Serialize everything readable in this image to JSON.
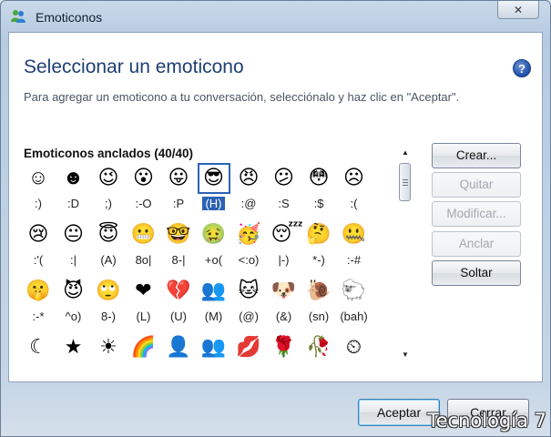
{
  "window": {
    "title": "Emoticonos",
    "close_label": "✕"
  },
  "header": {
    "heading": "Seleccionar un emoticono",
    "help": "?",
    "description": "Para agregar un emoticono a tu conversación, selecciónalo y haz clic en \"Aceptar\"."
  },
  "grid": {
    "title": "Emoticonos anclados (40/40)",
    "selected_index": 5,
    "rows": [
      [
        {
          "face": "☺",
          "code": ":)"
        },
        {
          "face": "☻",
          "code": ":D"
        },
        {
          "face": "😉",
          "code": ";)"
        },
        {
          "face": "😮",
          "code": ":-O"
        },
        {
          "face": "😛",
          "code": ":P"
        },
        {
          "face": "😎",
          "code": "(H)"
        },
        {
          "face": "😠",
          "code": ":@"
        },
        {
          "face": "😕",
          "code": ":S"
        },
        {
          "face": "😳",
          "code": ":$"
        },
        {
          "face": "☹",
          "code": ":("
        }
      ],
      [
        {
          "face": "😢",
          "code": ":'("
        },
        {
          "face": "😐",
          "code": ":|"
        },
        {
          "face": "😇",
          "code": "(A)"
        },
        {
          "face": "😬",
          "code": "8o|"
        },
        {
          "face": "🤓",
          "code": "8-|"
        },
        {
          "face": "🤢",
          "code": "+o("
        },
        {
          "face": "🥳",
          "code": "<:o)"
        },
        {
          "face": "😴",
          "code": "|-)"
        },
        {
          "face": "🤔",
          "code": "*-)"
        },
        {
          "face": "🤐",
          "code": ":-#"
        }
      ],
      [
        {
          "face": "🤫",
          "code": ":-*"
        },
        {
          "face": "😈",
          "code": "^o)"
        },
        {
          "face": "🙄",
          "code": "8-)"
        },
        {
          "face": "❤",
          "code": "(L)"
        },
        {
          "face": "💔",
          "code": "(U)"
        },
        {
          "face": "👥",
          "code": "(M)"
        },
        {
          "face": "🐱",
          "code": "(@)"
        },
        {
          "face": "🐶",
          "code": "(&)"
        },
        {
          "face": "🐌",
          "code": "(sn)"
        },
        {
          "face": "🐑",
          "code": "(bah)"
        }
      ],
      [
        {
          "face": "☾",
          "code": ""
        },
        {
          "face": "★",
          "code": ""
        },
        {
          "face": "☀",
          "code": ""
        },
        {
          "face": "🌈",
          "code": ""
        },
        {
          "face": "👤",
          "code": ""
        },
        {
          "face": "👥",
          "code": ""
        },
        {
          "face": "💋",
          "code": ""
        },
        {
          "face": "🌹",
          "code": ""
        },
        {
          "face": "🥀",
          "code": ""
        },
        {
          "face": "⏲",
          "code": ""
        }
      ]
    ]
  },
  "scrollbar": {
    "up": "▲",
    "down": "▼"
  },
  "side_buttons": [
    {
      "label": "Crear...",
      "enabled": true
    },
    {
      "label": "Quitar",
      "enabled": false
    },
    {
      "label": "Modificar...",
      "enabled": false
    },
    {
      "label": "Anclar",
      "enabled": false
    },
    {
      "label": "Soltar",
      "enabled": true
    }
  ],
  "footer": {
    "accept_label": "Aceptar",
    "cancel_label": "Cerrar"
  },
  "watermark": "Tecnología 7",
  "colors": {
    "heading": "#1e3f73",
    "selection": "#2b63b5",
    "window_frame": "#b7cbe0"
  }
}
